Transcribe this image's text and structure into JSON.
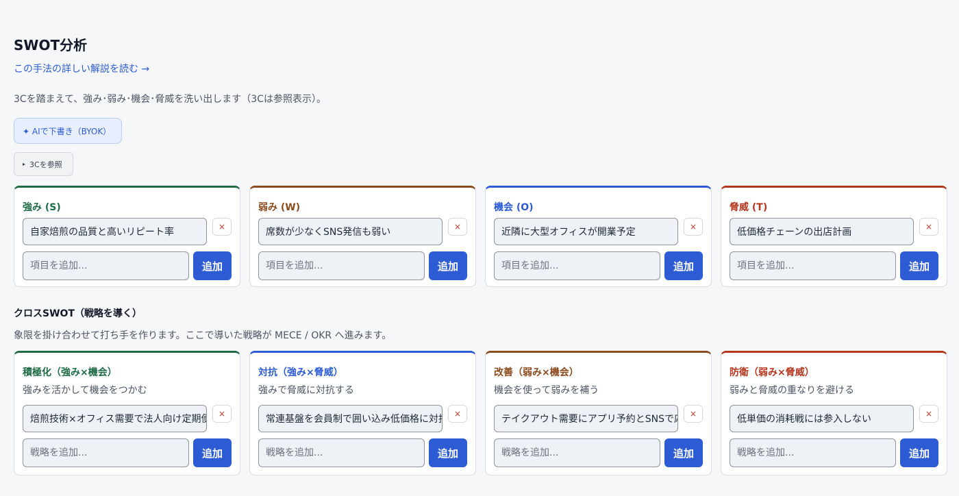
{
  "header": {
    "title": "SWOT分析",
    "guide_link": "この手法の詳しい解説を読む →",
    "description": "3Cを踏まえて、強み･弱み･機会･脅威を洗い出します（3Cは参照表示）。",
    "ai_button": "✦ AIで下書き（BYOK）",
    "ref_button": "3Cを参照"
  },
  "swot": [
    {
      "title": "強み (S)",
      "item": "自家焙煎の品質と高いリピート率",
      "placeholder": "項目を追加...",
      "delete": "×",
      "add": "追加"
    },
    {
      "title": "弱み (W)",
      "item": "席数が少なくSNS発信も弱い",
      "placeholder": "項目を追加...",
      "delete": "×",
      "add": "追加"
    },
    {
      "title": "機会 (O)",
      "item": "近隣に大型オフィスが開業予定",
      "placeholder": "項目を追加...",
      "delete": "×",
      "add": "追加"
    },
    {
      "title": "脅威 (T)",
      "item": "低価格チェーンの出店計画",
      "placeholder": "項目を追加...",
      "delete": "×",
      "add": "追加"
    }
  ],
  "cross": {
    "title": "クロスSWOT（戦略を導く）",
    "description": "象限を掛け合わせて打ち手を作ります。ここで導いた戦略が MECE / OKR へ進みます。",
    "cards": [
      {
        "title": "積極化（強み×機会）",
        "subtitle": "強みを活かして機会をつかむ",
        "item": "焙煎技術×オフィス需要で法人向け定期便",
        "placeholder": "戦略を追加...",
        "delete": "×",
        "add": "追加"
      },
      {
        "title": "対抗（強み×脅威）",
        "subtitle": "強みで脅威に対抗する",
        "item": "常連基盤を会員制で囲い込み低価格に対抗",
        "placeholder": "戦略を追加...",
        "delete": "×",
        "add": "追加"
      },
      {
        "title": "改善（弱み×機会）",
        "subtitle": "機会を使って弱みを補う",
        "item": "テイクアウト需要にアプリ予約とSNSで応える",
        "placeholder": "戦略を追加...",
        "delete": "×",
        "add": "追加"
      },
      {
        "title": "防衛（弱み×脅威）",
        "subtitle": "弱みと脅威の重なりを避ける",
        "item": "低単価の消耗戦には参入しない",
        "placeholder": "戦略を追加...",
        "delete": "×",
        "add": "追加"
      }
    ]
  },
  "colors": {
    "accent": "#2c5bd4",
    "strength": "#1f6b45",
    "weakness": "#8a4b1f",
    "opportunity": "#2c5bd4",
    "threat": "#b3361f"
  }
}
